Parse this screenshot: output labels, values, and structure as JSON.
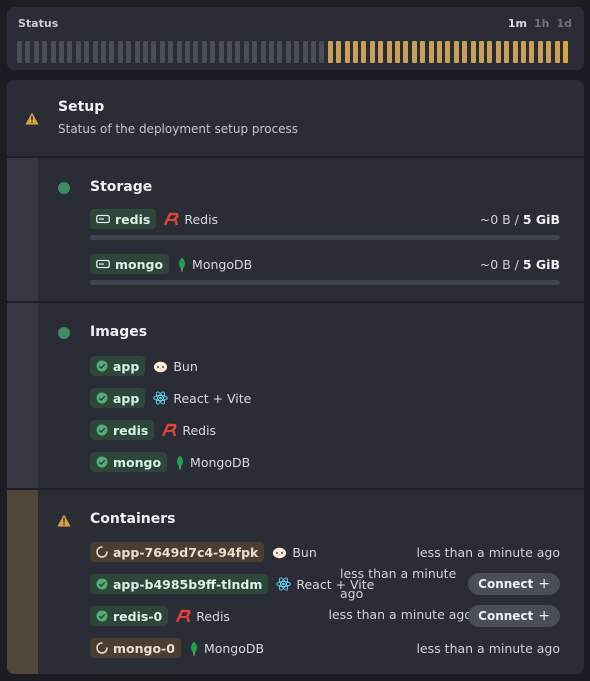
{
  "status": {
    "title": "Status",
    "ranges": [
      {
        "label": "1m",
        "active": true
      },
      {
        "label": "1h",
        "active": false
      },
      {
        "label": "1d",
        "active": false
      }
    ],
    "bars_total": 66,
    "bars_gray": 37,
    "colors": {
      "gray": "#4a4e58",
      "amber": "#c9a05a",
      "amber_last": "#d9a43c"
    }
  },
  "setup": {
    "title": "Setup",
    "subtitle": "Status of the deployment setup process"
  },
  "storage": {
    "title": "Storage",
    "items": [
      {
        "name": "redis",
        "tech": "Redis",
        "used": "~0 B",
        "sep": " / ",
        "limit": "5 GiB",
        "fill": 0.0
      },
      {
        "name": "mongo",
        "tech": "MongoDB",
        "used": "~0 B",
        "sep": " / ",
        "limit": "5 GiB",
        "fill": 0.0
      }
    ]
  },
  "images": {
    "title": "Images",
    "items": [
      {
        "name": "app",
        "tech": "Bun"
      },
      {
        "name": "app",
        "tech": "React + Vite"
      },
      {
        "name": "redis",
        "tech": "Redis"
      },
      {
        "name": "mongo",
        "tech": "MongoDB"
      }
    ]
  },
  "containers": {
    "title": "Containers",
    "items": [
      {
        "name": "app-7649d7c4-94fpk",
        "tech": "Bun",
        "time": "less than a minute ago",
        "state": "pending"
      },
      {
        "name": "app-b4985b9ff-tlndm",
        "tech": "React + Vite",
        "time": "less than a minute ago",
        "state": "ready",
        "action": "Connect"
      },
      {
        "name": "redis-0",
        "tech": "Redis",
        "time": "less than a minute ago",
        "state": "ready",
        "action": "Connect"
      },
      {
        "name": "mongo-0",
        "tech": "MongoDB",
        "time": "less than a minute ago",
        "state": "pending"
      }
    ]
  }
}
